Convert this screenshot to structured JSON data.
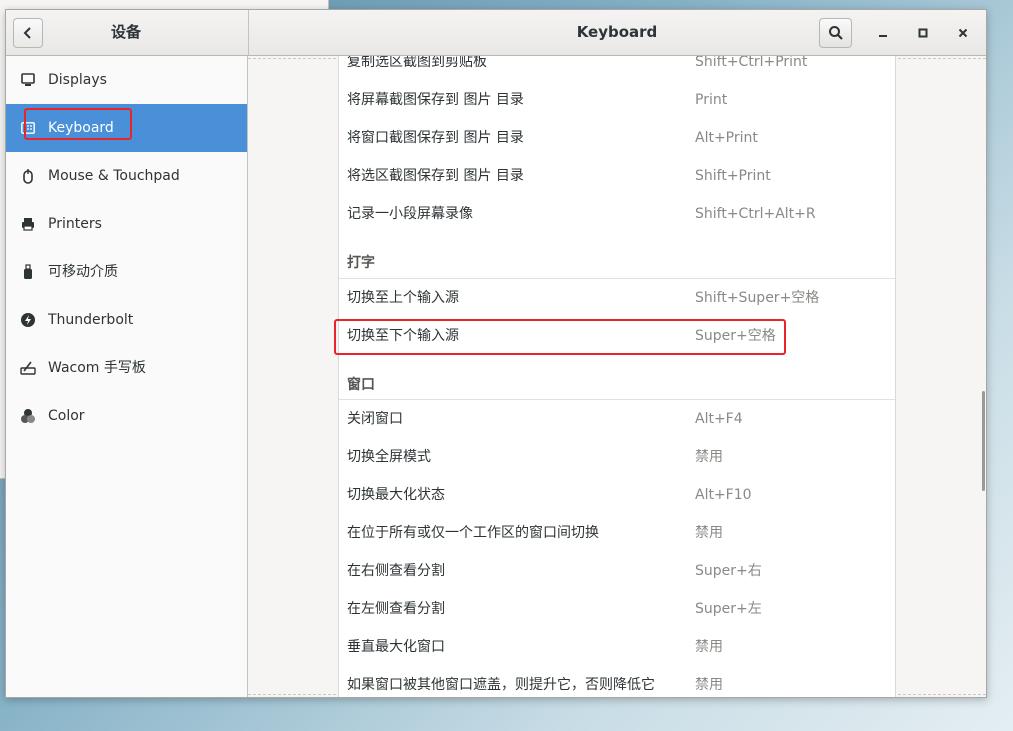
{
  "header": {
    "left_title": "设备",
    "title": "Keyboard"
  },
  "sidebar": {
    "items": [
      {
        "label": "Displays",
        "icon": "display-icon"
      },
      {
        "label": "Keyboard",
        "icon": "keyboard-icon",
        "selected": true
      },
      {
        "label": "Mouse & Touchpad",
        "icon": "mouse-icon"
      },
      {
        "label": "Printers",
        "icon": "printer-icon"
      },
      {
        "label": "可移动介质",
        "icon": "removable-media-icon"
      },
      {
        "label": "Thunderbolt",
        "icon": "thunderbolt-icon"
      },
      {
        "label": "Wacom 手写板",
        "icon": "tablet-icon"
      },
      {
        "label": "Color",
        "icon": "color-icon"
      }
    ]
  },
  "shortcuts": {
    "screenshot_rows": [
      {
        "name": "复制选区截图到剪贴板",
        "accel": "Shift+Ctrl+Print"
      },
      {
        "name": "将屏幕截图保存到 图片 目录",
        "accel": "Print"
      },
      {
        "name": "将窗口截图保存到 图片 目录",
        "accel": "Alt+Print"
      },
      {
        "name": "将选区截图保存到 图片 目录",
        "accel": "Shift+Print"
      },
      {
        "name": "记录一小段屏幕录像",
        "accel": "Shift+Ctrl+Alt+R"
      }
    ],
    "typing_title": "打字",
    "typing_rows": [
      {
        "name": "切换至上个输入源",
        "accel": "Shift+Super+空格"
      },
      {
        "name": "切换至下个输入源",
        "accel": "Super+空格"
      }
    ],
    "windows_title": "窗口",
    "windows_rows": [
      {
        "name": "关闭窗口",
        "accel": "Alt+F4"
      },
      {
        "name": "切换全屏模式",
        "accel": "禁用"
      },
      {
        "name": "切换最大化状态",
        "accel": "Alt+F10"
      },
      {
        "name": "在位于所有或仅一个工作区的窗口间切换",
        "accel": "禁用"
      },
      {
        "name": "在右侧查看分割",
        "accel": "Super+右"
      },
      {
        "name": "在左侧查看分割",
        "accel": "Super+左"
      },
      {
        "name": "垂直最大化窗口",
        "accel": "禁用"
      },
      {
        "name": "如果窗口被其他窗口遮盖，则提升它，否则降低它",
        "accel": "禁用"
      }
    ]
  },
  "colors": {
    "selection": "#4a90d9",
    "highlight_box": "#e8262a"
  }
}
